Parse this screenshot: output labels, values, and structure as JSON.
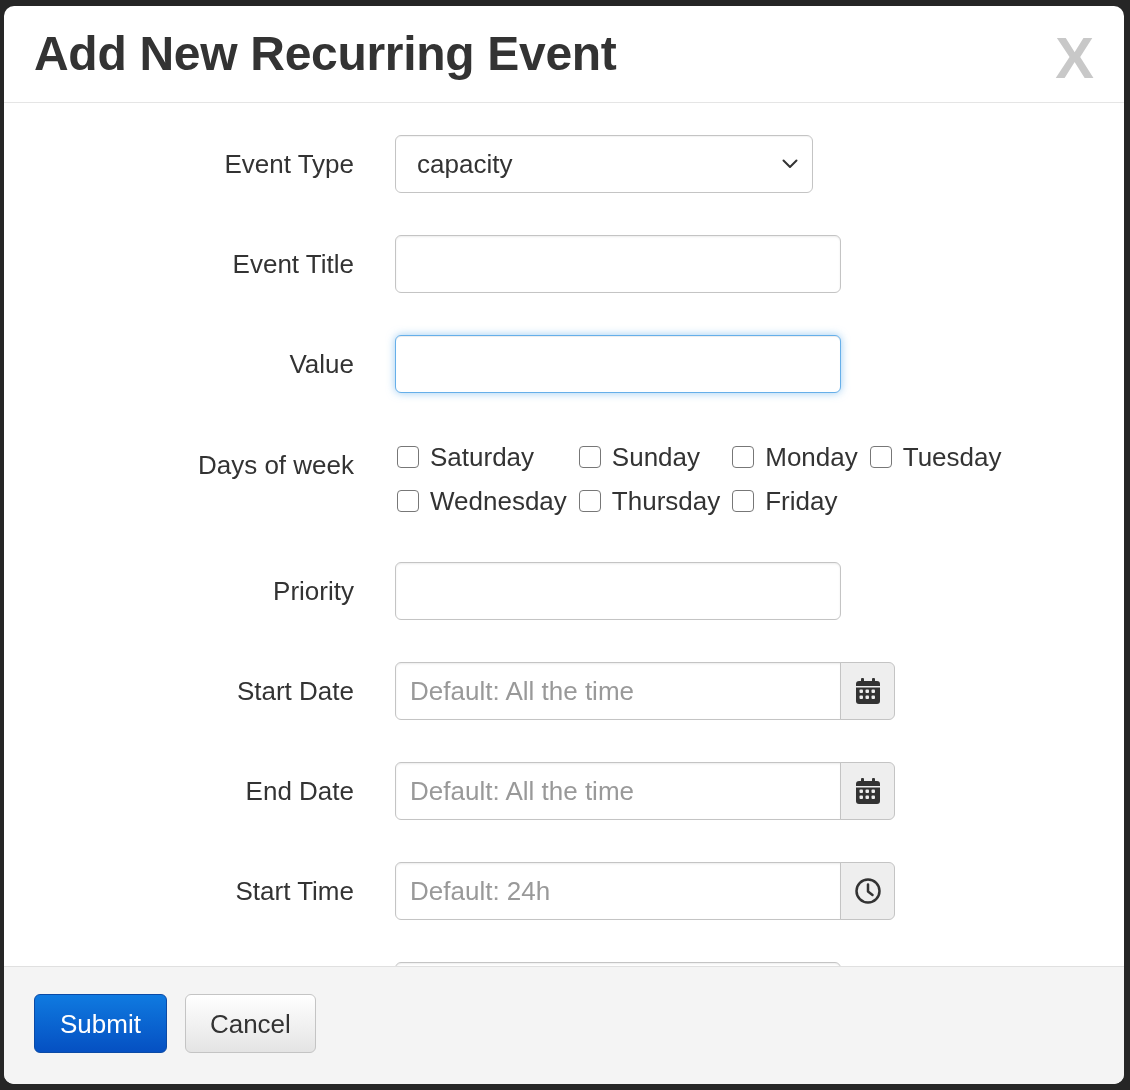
{
  "dialog": {
    "title": "Add New Recurring Event",
    "close": "X"
  },
  "fields": [
    {
      "kind": "select",
      "label": "Event Type",
      "value": "capacity",
      "focused": false
    },
    {
      "kind": "text",
      "label": "Event Title",
      "focused": false
    },
    {
      "kind": "text",
      "label": "Value",
      "focused": true
    },
    {
      "kind": "checkboxes",
      "label": "Days of week",
      "options": [
        {
          "label": "Saturday",
          "checked": false
        },
        {
          "label": "Sunday",
          "checked": false
        },
        {
          "label": "Monday",
          "checked": false
        },
        {
          "label": "Tuesday",
          "checked": false
        },
        {
          "label": "Wednesday",
          "checked": false
        },
        {
          "label": "Thursday",
          "checked": false
        },
        {
          "label": "Friday",
          "checked": false
        }
      ]
    },
    {
      "kind": "text",
      "label": "Priority",
      "focused": false
    },
    {
      "kind": "date",
      "label": "Start Date",
      "placeholder": "Default: All the time",
      "focused": false
    },
    {
      "kind": "date",
      "label": "End Date",
      "placeholder": "Default: All the time",
      "focused": false
    },
    {
      "kind": "time",
      "label": "Start Time",
      "placeholder": "Default: 24h",
      "focused": false
    },
    {
      "kind": "text",
      "focused": false
    }
  ],
  "buttons": [
    {
      "label": "Submit",
      "kind": "primary"
    },
    {
      "label": "Cancel",
      "kind": "default"
    }
  ]
}
